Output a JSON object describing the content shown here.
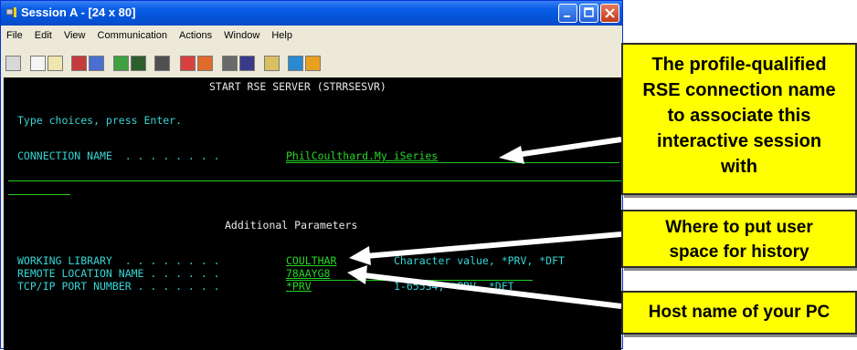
{
  "window": {
    "title": "Session A - [24 x 80]",
    "menu": [
      "File",
      "Edit",
      "View",
      "Communication",
      "Actions",
      "Window",
      "Help"
    ]
  },
  "terminal": {
    "header": "START RSE SERVER (STRRSESVR)",
    "prompt": "Type choices, press Enter.",
    "connection": {
      "label": "CONNECTION NAME  . . . . . . . .",
      "value": "PhilCoulthard.My iSeries"
    },
    "additional": "Additional Parameters",
    "working_library": {
      "label": "WORKING LIBRARY  . . . . . . . .",
      "value": "COULTHAR",
      "hint": "Character value, *PRV, *DFT"
    },
    "remote_location": {
      "label": "REMOTE LOCATION NAME . . . . . .",
      "value": "78AAYG8"
    },
    "port": {
      "label": "TCP/IP PORT NUMBER . . . . . . .",
      "value": "*PRV",
      "hint": "1-65534, *PRV, *DFT"
    }
  },
  "callouts": {
    "c1": [
      "The profile-qualified",
      "RSE connection name",
      "to associate this",
      "interactive session",
      "with"
    ],
    "c2": [
      "Where to put user",
      "space for history"
    ],
    "c3": "Host name of your PC"
  },
  "colors": {
    "terminal_bg": "#000000",
    "field_green": "#25d825",
    "label_cyan": "#35d4d4",
    "callout_yellow": "#ffff00",
    "titlebar_blue": "#0553d7"
  },
  "icons": [
    "session-icon",
    "minimize-icon",
    "maximize-icon",
    "close-icon"
  ]
}
